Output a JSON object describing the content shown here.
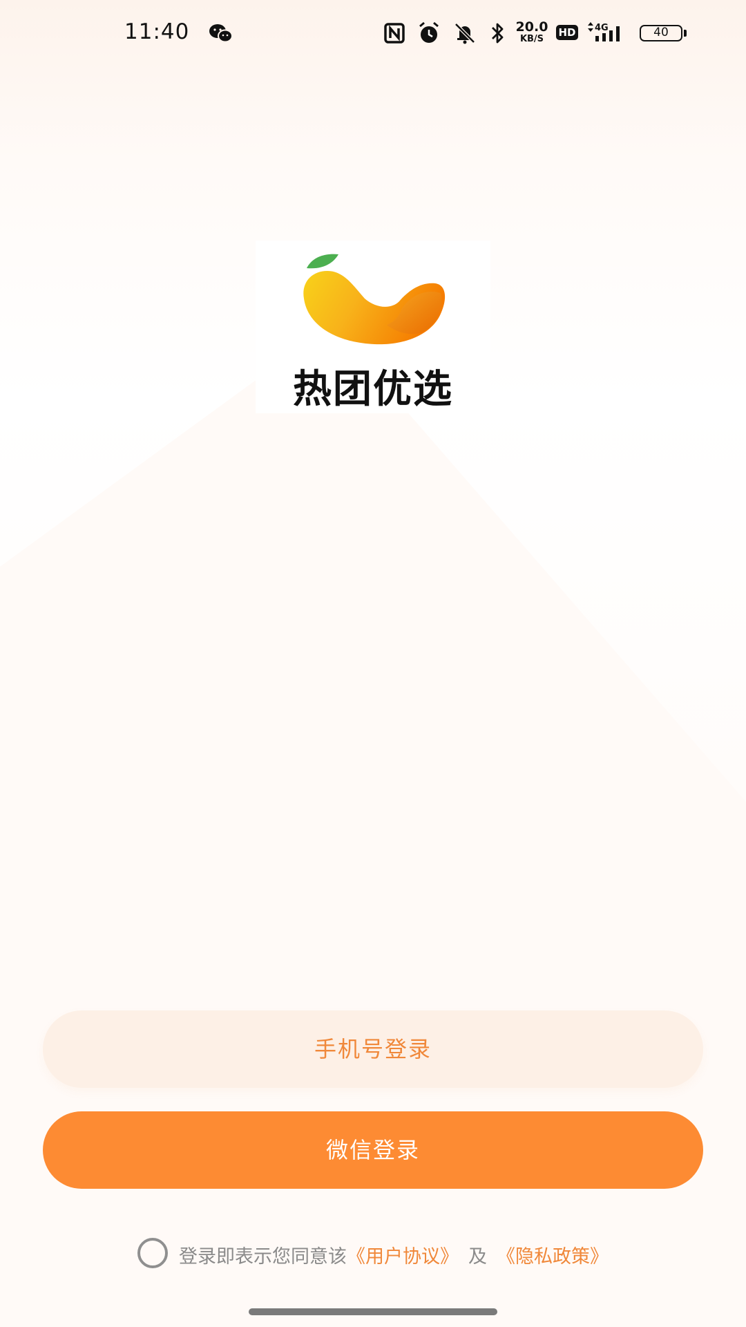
{
  "status_bar": {
    "time": "11:40",
    "net_speed_value": "20.0",
    "net_speed_unit": "KB/S",
    "hd_label": "HD",
    "signal_label": "4G",
    "battery_level": "40",
    "icons": [
      "wechat-icon",
      "nfc-icon",
      "alarm-icon",
      "mute-icon",
      "bluetooth-icon",
      "signal-icon",
      "battery-icon"
    ]
  },
  "logo": {
    "brand_name": "热团优选",
    "colors": {
      "leaf": "#4caf50",
      "fruit_yellow": "#f5c518",
      "fruit_orange": "#f57c00"
    }
  },
  "buttons": {
    "phone_login": "手机号登录",
    "wechat_login": "微信登录"
  },
  "agreement": {
    "text": "登录即表示您同意该",
    "user_agreement": "《用户协议》",
    "and": "及",
    "privacy_policy": "《隐私政策》",
    "checked": false
  },
  "colors": {
    "accent": "#fd8b33",
    "accent_light": "#fdf0e6",
    "link": "#f0883a"
  }
}
